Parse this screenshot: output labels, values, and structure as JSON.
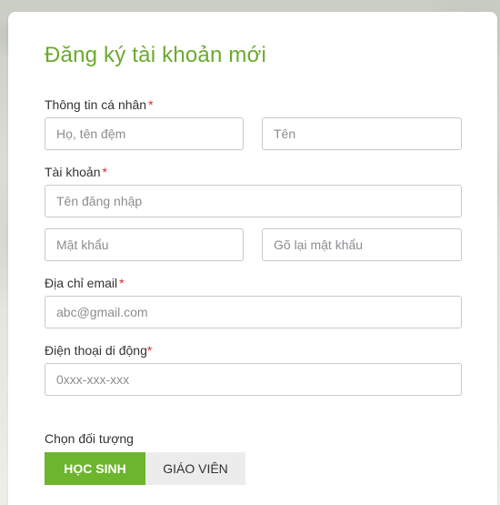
{
  "form": {
    "title": "Đăng ký tài khoản mới",
    "personal_info": {
      "label": "Thông tin cá nhân",
      "required_mark": "*",
      "last_name_placeholder": "Họ, tên đệm",
      "first_name_placeholder": "Tên"
    },
    "account": {
      "label": "Tài khoản",
      "required_mark": "*",
      "username_placeholder": "Tên đăng nhập",
      "password_placeholder": "Mật khẩu",
      "confirm_password_placeholder": "Gõ lại mật khẩu"
    },
    "email": {
      "label": "Địa chỉ email",
      "required_mark": "*",
      "placeholder": "abc@gmail.com"
    },
    "phone": {
      "label": "Điện thoại di động",
      "required_mark": "*",
      "placeholder": "0xxx-xxx-xxx"
    },
    "role": {
      "label": "Chọn đối tượng",
      "options": [
        "HỌC SINH",
        "GIÁO VIÊN"
      ],
      "selected": "HỌC SINH"
    }
  },
  "colors": {
    "accent": "#6cb52d",
    "title": "#6aaa2e",
    "required": "#e0262b",
    "inactive_button": "#ececec"
  }
}
